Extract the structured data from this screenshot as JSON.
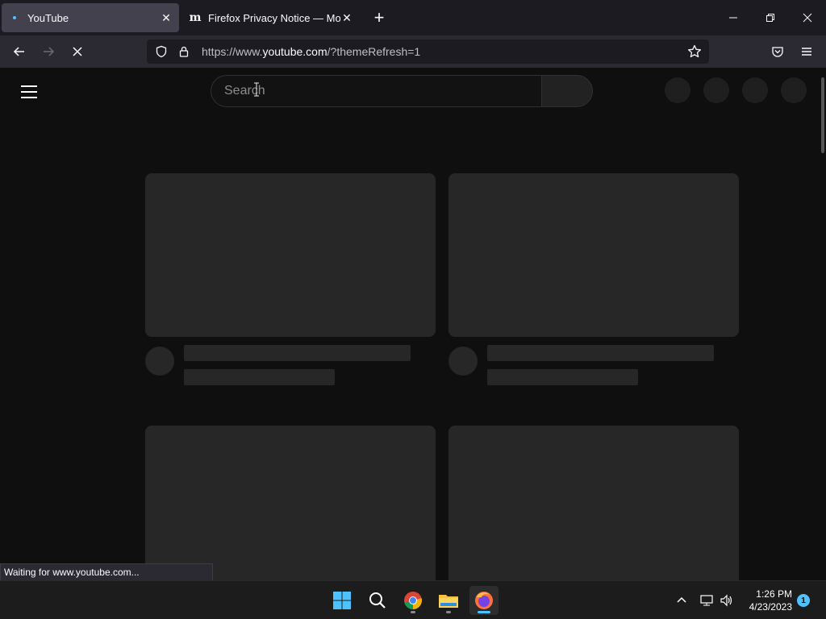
{
  "browser": {
    "tabs": [
      {
        "title": "YouTube",
        "favicon": "loading-dot-icon",
        "active": true
      },
      {
        "title": "Firefox Privacy Notice — Mozill",
        "favicon_text": "m",
        "active": false
      }
    ],
    "url": {
      "prefix": "https://www.",
      "host": "youtube.com",
      "suffix": "/?themeRefresh=1"
    },
    "status_text": "Waiting for www.youtube.com..."
  },
  "youtube": {
    "search_placeholder": "Search"
  },
  "taskbar": {
    "apps": [
      "windows-start-icon",
      "search-icon",
      "chrome-icon",
      "file-explorer-icon",
      "firefox-icon"
    ],
    "time": "1:26 PM",
    "date": "4/23/2023",
    "notification_count": "1"
  },
  "colors": {
    "accent": "#4cc2ff",
    "skeleton": "#272727",
    "page_bg": "#0f0f0f",
    "tab_bg": "#1c1b22",
    "toolbar_bg": "#2b2a33"
  }
}
